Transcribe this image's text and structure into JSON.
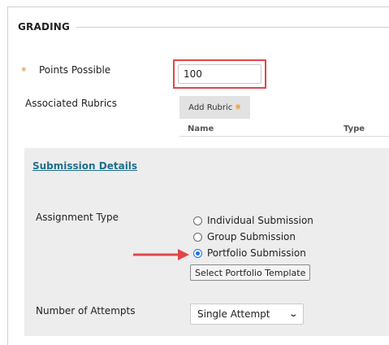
{
  "section": {
    "title": "GRADING"
  },
  "points": {
    "label": "Points Possible",
    "required_marker": "*",
    "value": "100"
  },
  "rubrics": {
    "label": "Associated Rubrics",
    "add_button": "Add Rubric",
    "add_button_icon": "double-chevron-down-icon",
    "columns": [
      "Name",
      "Type"
    ]
  },
  "submission_details": {
    "link": "Submission Details",
    "assignment_type": {
      "label": "Assignment Type",
      "options": [
        "Individual Submission",
        "Group Submission",
        "Portfolio Submission"
      ],
      "selected": "Portfolio Submission"
    },
    "portfolio_template_button": "Select Portfolio Template",
    "attempts": {
      "label": "Number of Attempts",
      "value": "Single Attempt"
    }
  },
  "colors": {
    "highlight": "#e0464a",
    "arrow": "#e0464a",
    "link": "#1f6f8b",
    "required": "#e08a2e",
    "panel": "#ededed"
  }
}
